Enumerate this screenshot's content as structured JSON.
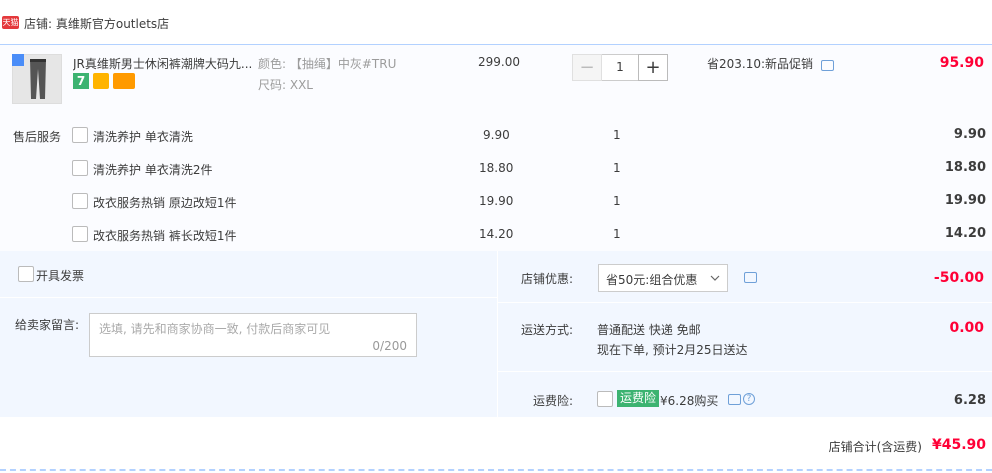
{
  "shop": {
    "badge": "天猫",
    "label": "店铺: 真维斯官方outlets店"
  },
  "item": {
    "title": "JR真维斯男士休闲裤潮牌大码九...",
    "badge_7": "7",
    "color_label": "颜色: 【抽绳】中灰#TRU",
    "size_label": "尺码: XXL",
    "unit_price": "299.00",
    "quantity": "1",
    "minus": "−",
    "plus": "+",
    "promo": "省203.10:新品促销",
    "subtotal": "95.90"
  },
  "services": {
    "label": "售后服务",
    "rows": [
      {
        "name": "清洗养护 单衣清洗",
        "price": "9.90",
        "qty": "1",
        "total": "9.90"
      },
      {
        "name": "清洗养护 单衣清洗2件",
        "price": "18.80",
        "qty": "1",
        "total": "18.80"
      },
      {
        "name": "改衣服务热销 原边改短1件",
        "price": "19.90",
        "qty": "1",
        "total": "19.90"
      },
      {
        "name": "改衣服务热销 裤长改短1件",
        "price": "14.20",
        "qty": "1",
        "total": "14.20"
      }
    ]
  },
  "invoice": {
    "label": "开具发票"
  },
  "message": {
    "label": "给卖家留言:",
    "placeholder": "选填, 请先和商家协商一致, 付款后商家可见",
    "counter": "0/200"
  },
  "discount": {
    "label": "店铺优惠:",
    "selected": "省50元:组合优惠",
    "amount": "-50.00"
  },
  "shipping": {
    "label": "运送方式:",
    "method": "普通配送 快递 免邮",
    "eta": "现在下单, 预计2月25日送达",
    "amount": "0.00"
  },
  "insurance": {
    "label": "运费险:",
    "tag": "运费险",
    "price_text": "¥6.28购买",
    "amount": "6.28"
  },
  "footer": {
    "label": "店铺合计(含运费)",
    "total": "¥45.90"
  },
  "colors": {
    "accent_red": "#ff0036",
    "panel_bg": "#f2f7ff",
    "border_blue": "#b2d1ff",
    "tag_green": "#3cb371"
  }
}
